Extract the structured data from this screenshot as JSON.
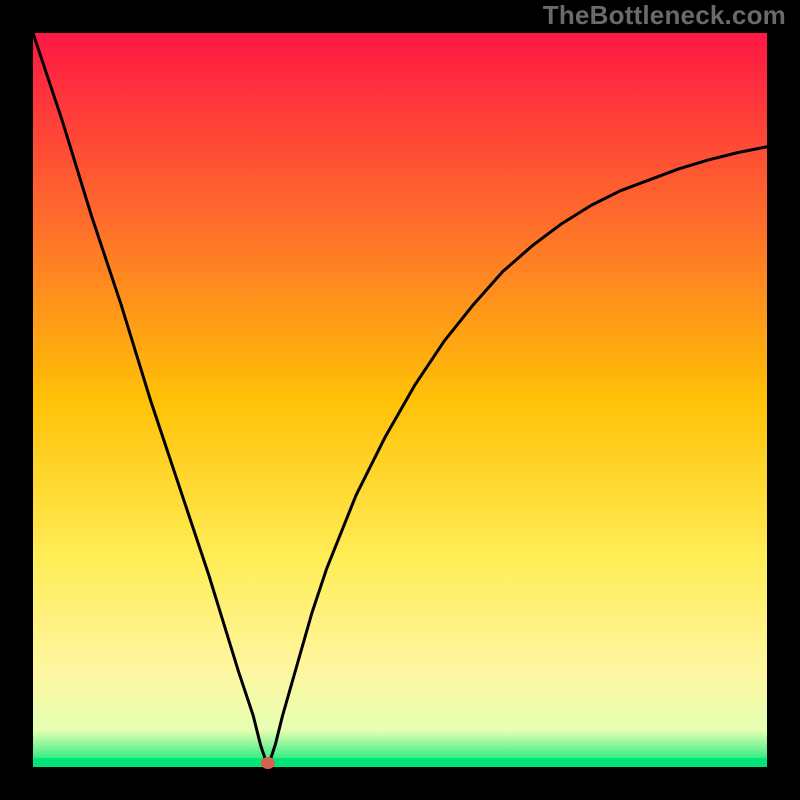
{
  "watermark": "TheBottleneck.com",
  "chart_data": {
    "type": "line",
    "title": "",
    "xlabel": "",
    "ylabel": "",
    "xlim": [
      0,
      100
    ],
    "ylim": [
      0,
      100
    ],
    "background_gradient": {
      "direction": "vertical",
      "stops": [
        {
          "pos": 0.0,
          "color": "#ff1744"
        },
        {
          "pos": 0.25,
          "color": "#ff6b2c"
        },
        {
          "pos": 0.5,
          "color": "#ffc107"
        },
        {
          "pos": 0.72,
          "color": "#ffee58"
        },
        {
          "pos": 0.86,
          "color": "#fff59d"
        },
        {
          "pos": 0.95,
          "color": "#e6ffb3"
        },
        {
          "pos": 1.0,
          "color": "#00e676"
        }
      ]
    },
    "bottom_band_color": "#00e676",
    "marker": {
      "x": 32,
      "y": 0,
      "color": "#d6614f"
    },
    "series": [
      {
        "name": "curve",
        "color": "#000000",
        "x": [
          0,
          4,
          8,
          12,
          16,
          20,
          24,
          28,
          30,
          31,
          32,
          33,
          34,
          36,
          38,
          40,
          44,
          48,
          52,
          56,
          60,
          64,
          68,
          72,
          76,
          80,
          84,
          88,
          92,
          96,
          100
        ],
        "values": [
          100,
          88,
          75,
          63,
          50,
          38,
          26,
          13,
          7,
          3,
          0,
          3,
          7,
          14,
          21,
          27,
          37,
          45,
          52,
          58,
          63,
          67.5,
          71,
          74,
          76.5,
          78.5,
          80,
          81.5,
          82.7,
          83.7,
          84.5
        ]
      }
    ],
    "annotations": []
  }
}
